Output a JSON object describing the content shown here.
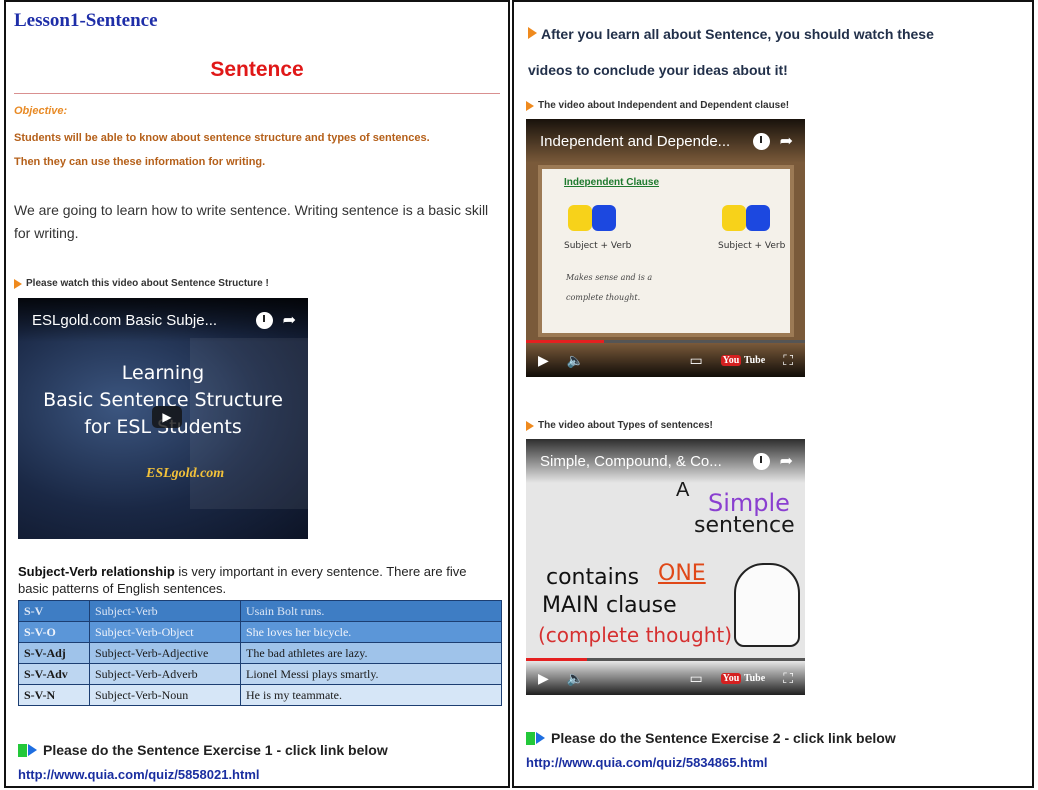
{
  "left": {
    "lesson_title": "Lesson1-Sentence",
    "main_title": "Sentence",
    "objective_label": "Objective:",
    "objective_lines": [
      "Students will be able to know about sentence structure and types of sentences.",
      "Then they can use these information for writing."
    ],
    "intro": "We are going to learn how to write sentence. Writing sentence is a basic skill for writing.",
    "video_caption": "Please watch this video about Sentence Structure !",
    "video": {
      "title": "ESLgold.com Basic Subje...",
      "lines": [
        "Learning",
        "Basic Sentence Structure",
        "for ESL Students"
      ],
      "logo": "ESLgold.com"
    },
    "relationship_bold": "Subject-Verb relationship",
    "relationship_rest": " is very important in every sentence. There are five basic patterns of English sentences.",
    "patterns": [
      {
        "code": "S-V",
        "name": "Subject-Verb",
        "example": "Usain Bolt runs."
      },
      {
        "code": "S-V-O",
        "name": "Subject-Verb-Object",
        "example": "She loves her bicycle."
      },
      {
        "code": "S-V-Adj",
        "name": "Subject-Verb-Adjective",
        "example": "The bad athletes are lazy."
      },
      {
        "code": "S-V-Adv",
        "name": "Subject-Verb-Adverb",
        "example": "Lionel Messi plays smartly."
      },
      {
        "code": "S-V-N",
        "name": "Subject-Verb-Noun",
        "example": "He is my teammate."
      }
    ],
    "exercise": "Please do the Sentence Exercise  1 - click link below",
    "link": "http://www.quia.com/quiz/5858021.html"
  },
  "right": {
    "heading_line1": "After you learn all about Sentence, you should watch these",
    "heading_line2": "videos to conclude your ideas about it!",
    "video1_caption": "The video about Independent and Dependent clause!",
    "video1": {
      "title": "Independent and Depende...",
      "board_title": "Independent Clause",
      "label_left": "Subject + Verb",
      "label_right": "Subject + Verb",
      "note1": "Makes sense and is a",
      "note2": "complete thought."
    },
    "video2_caption": "The video about Types of sentences!",
    "video2": {
      "title": "Simple, Compound, & Co...",
      "w_a": "A",
      "w_simple": "Simple",
      "w_sentence": "sentence",
      "w_contains": "contains",
      "w_one": "ONE",
      "w_main": "MAIN clause",
      "w_complete": "(complete thought)"
    },
    "exercise": "Please do the Sentence Exercise  2 - click link below",
    "link": "http://www.quia.com/quiz/5834865.html"
  },
  "player": {
    "youtube": "You",
    "youtube_tube": "Tube"
  },
  "colors": {
    "lesson_title": "#1e2ea8",
    "main_title": "#e01818",
    "objective": "#e88a25",
    "link": "#1a2ea0",
    "table_dark": "#3e7dc4",
    "table_light": "#d6e6f7"
  }
}
